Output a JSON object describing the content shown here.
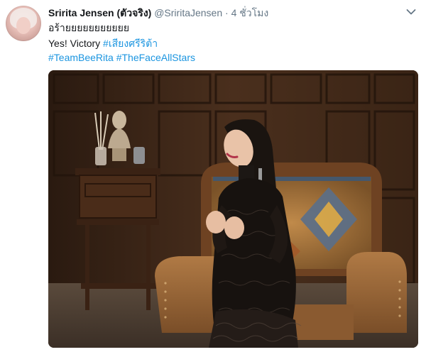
{
  "tweet": {
    "author_name": "Sririta Jensen (ตัวจริง)",
    "handle": "@SriritaJensen",
    "separator": "·",
    "time": "4 ชั่วโมง",
    "line1": "อร้ายยยยยยยยยยย",
    "line2_text": "Yes! Victory ",
    "line2_hashtag": "#เสียงศรีริต้า",
    "hashtag_team": "#TeamBeeRita",
    "hashtag_show": "#TheFaceAllStars"
  },
  "colors": {
    "link": "#1b95e0",
    "secondary_text": "#657786",
    "primary_text": "#14171a"
  },
  "icons": {
    "menu": "chevron-down-icon"
  },
  "media": {
    "description_icon": "photo"
  }
}
